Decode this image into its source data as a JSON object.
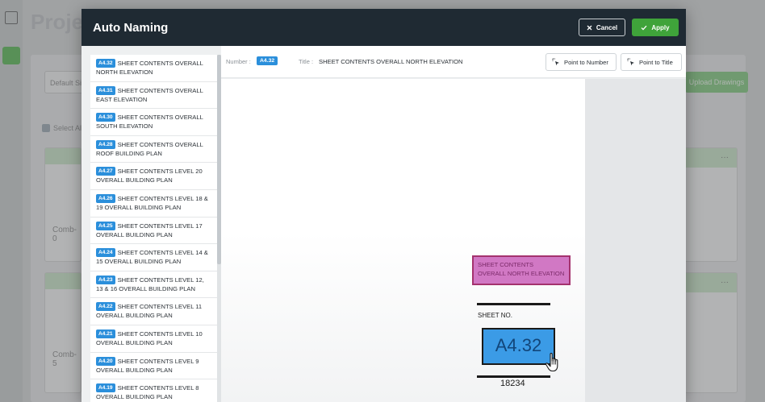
{
  "background": {
    "page_title": "Proje",
    "default_select": "Default Si",
    "select_all": "Select Al",
    "upload_button": "Upload Drawings",
    "cards": [
      "Comb-0",
      "Comb-5"
    ],
    "card_menu": "···"
  },
  "modal": {
    "title": "Auto Naming",
    "cancel_label": "Cancel",
    "apply_label": "Apply"
  },
  "toolbar": {
    "number_label": "Number :",
    "number_value": "A4.32",
    "title_label": "Title :",
    "title_value": "SHEET CONTENTS OVERALL NORTH ELEVATION",
    "point_to_number": "Point to Number",
    "point_to_title": "Point to Title"
  },
  "sheets": [
    {
      "number": "A4.32",
      "title": "SHEET CONTENTS OVERALL NORTH ELEVATION"
    },
    {
      "number": "A4.31",
      "title": "SHEET CONTENTS OVERALL EAST ELEVATION"
    },
    {
      "number": "A4.30",
      "title": "SHEET CONTENTS OVERALL SOUTH ELEVATION"
    },
    {
      "number": "A4.28",
      "title": "SHEET CONTENTS OVERALL ROOF BUILDING PLAN"
    },
    {
      "number": "A4.27",
      "title": "SHEET CONTENTS LEVEL 20 OVERALL BUILDING PLAN"
    },
    {
      "number": "A4.26",
      "title": "SHEET CONTENTS LEVEL 18 & 19 OVERALL BUILDING PLAN"
    },
    {
      "number": "A4.25",
      "title": "SHEET CONTENTS LEVEL 17 OVERALL BUILDING PLAN"
    },
    {
      "number": "A4.24",
      "title": "SHEET CONTENTS LEVEL 14 & 15 OVERALL BUILDING PLAN"
    },
    {
      "number": "A4.23",
      "title": "SHEET CONTENTS LEVEL 12, 13 & 16 OVERALL BUILDING PLAN"
    },
    {
      "number": "A4.22",
      "title": "SHEET CONTENTS LEVEL 11 OVERALL BUILDING PLAN"
    },
    {
      "number": "A4.21",
      "title": "SHEET CONTENTS LEVEL 10 OVERALL BUILDING PLAN"
    },
    {
      "number": "A4.20",
      "title": "SHEET CONTENTS LEVEL 9 OVERALL BUILDING PLAN"
    },
    {
      "number": "A4.19",
      "title": "SHEET CONTENTS LEVEL 8 OVERALL BUILDING PLAN"
    }
  ],
  "drawing": {
    "title_box_lines": [
      "SHEET CONTENTS",
      "OVERALL NORTH ELEVATION"
    ],
    "sheet_no_label": "SHEET NO.",
    "sheet_number": "A4.32",
    "drawing_number": "18234"
  },
  "colors": {
    "header_bg": "#1f2a33",
    "apply_green": "#3fa33a",
    "badge_blue": "#2b8fdb",
    "title_highlight": "#d178c4",
    "number_highlight": "#3b9be6"
  },
  "icons": {
    "cancel": "close-icon",
    "apply": "check-icon",
    "point": "pointer-select-icon",
    "cursor": "hand-pointer-icon"
  }
}
